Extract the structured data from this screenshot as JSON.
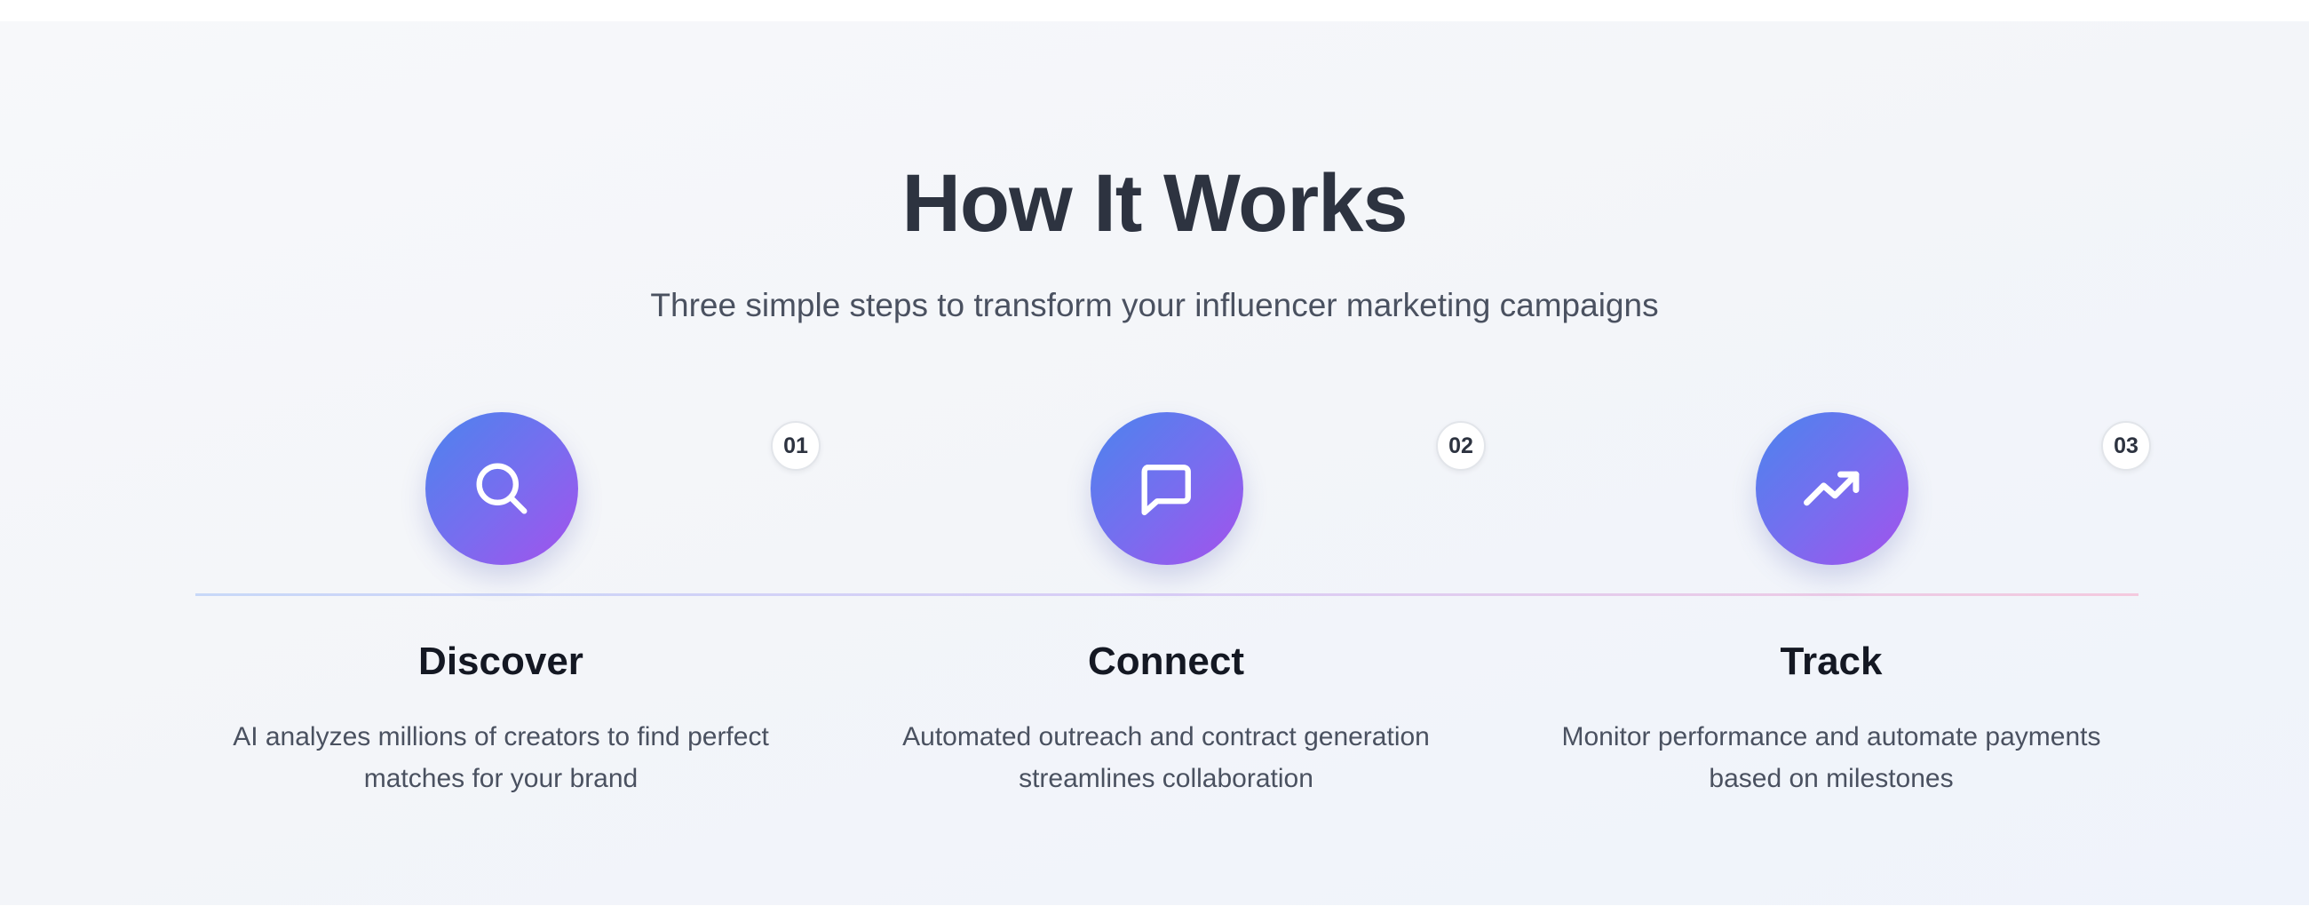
{
  "section": {
    "title": "How It Works",
    "subtitle": "Three simple steps to transform your influencer marketing campaigns"
  },
  "colors": {
    "gradient_start": "#4b84ee",
    "gradient_end": "#a451ec",
    "heading": "#2d3340",
    "body_text": "#4a5160"
  },
  "steps": [
    {
      "number": "01",
      "icon": "search-icon",
      "title": "Discover",
      "description": "AI analyzes millions of creators to find perfect matches for your brand"
    },
    {
      "number": "02",
      "icon": "chat-bubble-icon",
      "title": "Connect",
      "description": "Automated outreach and contract generation streamlines collaboration"
    },
    {
      "number": "03",
      "icon": "trending-up-icon",
      "title": "Track",
      "description": "Monitor performance and automate payments based on milestones"
    }
  ]
}
